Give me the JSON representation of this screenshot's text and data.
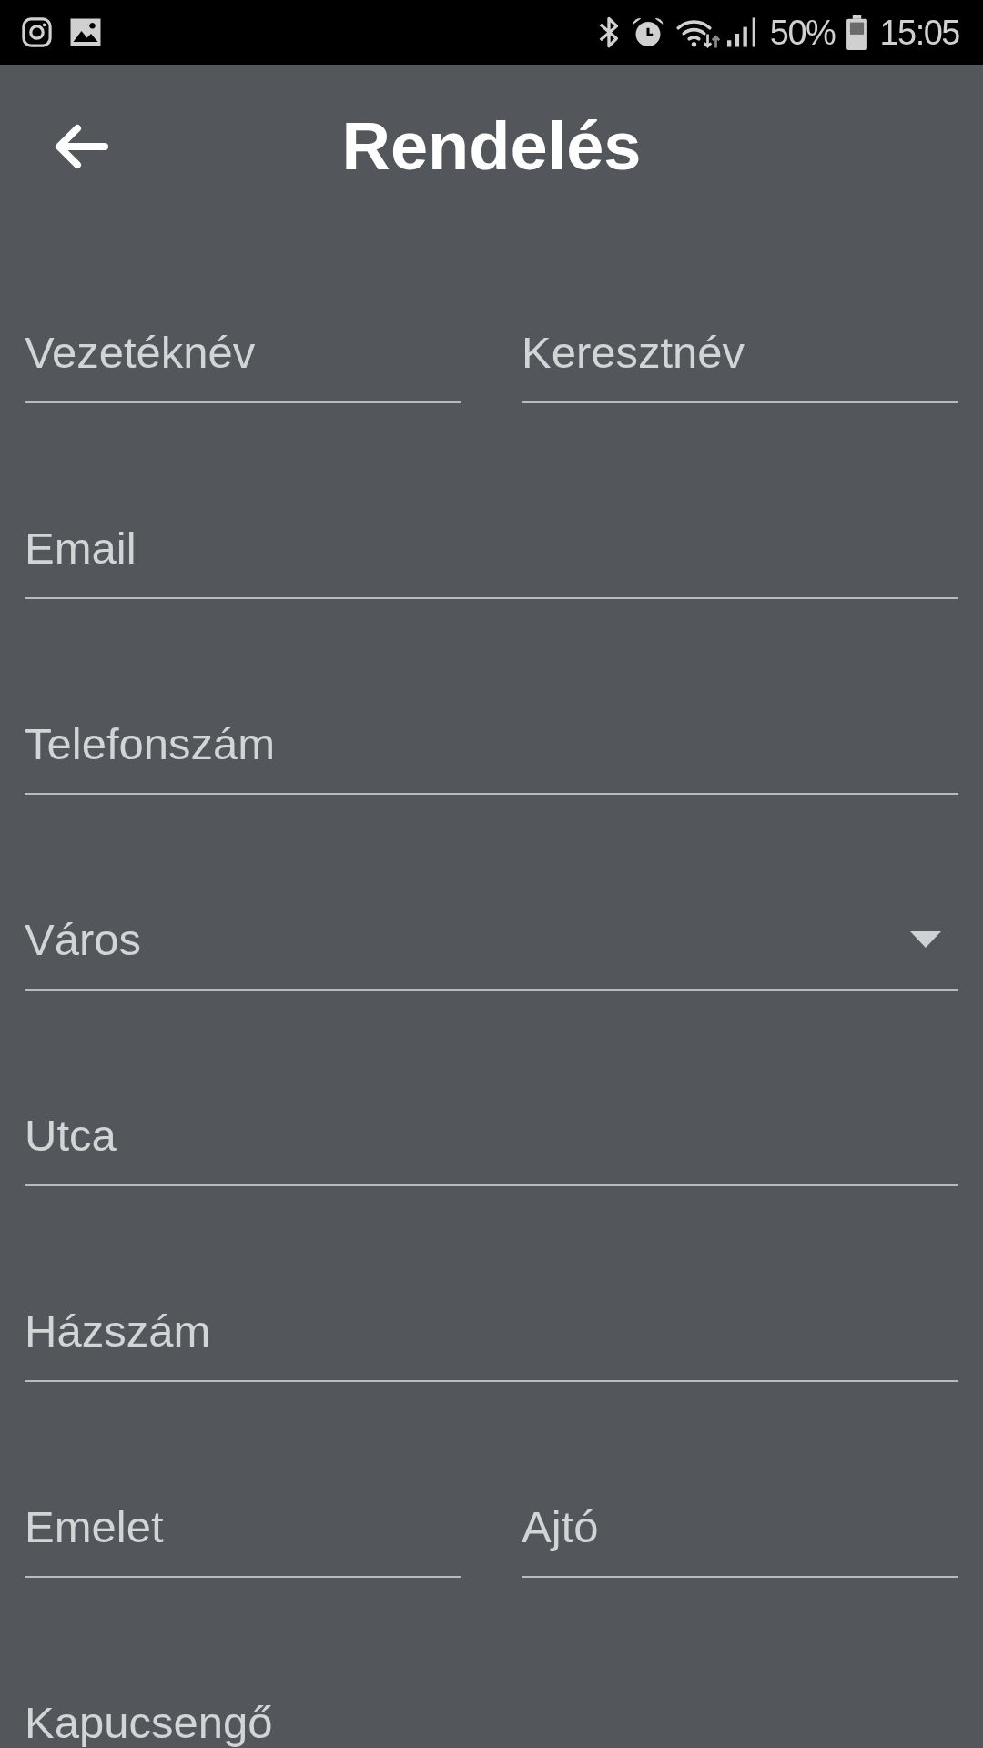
{
  "status_bar": {
    "battery": "50%",
    "time": "15:05"
  },
  "header": {
    "title": "Rendelés"
  },
  "form": {
    "rows": [
      {
        "fields": [
          {
            "kind": "text",
            "placeholder": "Vezetéknév"
          },
          {
            "kind": "text",
            "placeholder": "Keresztnév"
          }
        ]
      },
      {
        "fields": [
          {
            "kind": "text",
            "placeholder": "Email"
          }
        ]
      },
      {
        "fields": [
          {
            "kind": "text",
            "placeholder": "Telefonszám"
          }
        ]
      },
      {
        "fields": [
          {
            "kind": "dropdown",
            "placeholder": "Város"
          }
        ]
      },
      {
        "fields": [
          {
            "kind": "text",
            "placeholder": "Utca"
          }
        ]
      },
      {
        "fields": [
          {
            "kind": "text",
            "placeholder": "Házszám"
          }
        ]
      },
      {
        "fields": [
          {
            "kind": "text",
            "placeholder": "Emelet"
          },
          {
            "kind": "text",
            "placeholder": "Ajtó"
          }
        ]
      },
      {
        "fields": [
          {
            "kind": "text",
            "placeholder": "Kapucsengő"
          }
        ]
      }
    ]
  }
}
